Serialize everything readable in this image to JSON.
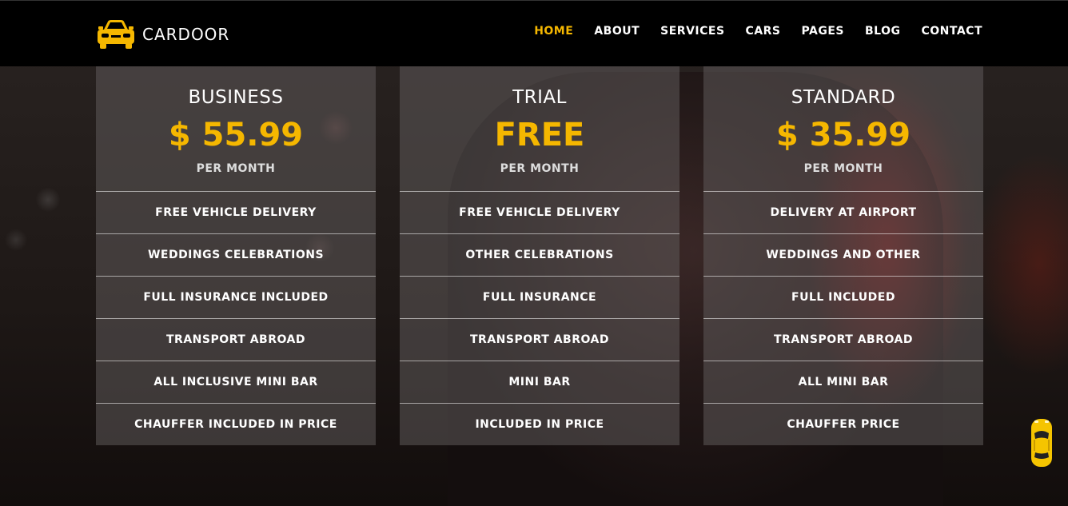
{
  "brand": {
    "name": "CARDOOR",
    "accent_color": "#f5b700",
    "logo_icon": "car-front-icon"
  },
  "nav": {
    "items": [
      {
        "label": "HOME",
        "active": true
      },
      {
        "label": "ABOUT",
        "active": false
      },
      {
        "label": "SERVICES",
        "active": false
      },
      {
        "label": "CARS",
        "active": false
      },
      {
        "label": "PAGES",
        "active": false
      },
      {
        "label": "BLOG",
        "active": false
      },
      {
        "label": "CONTACT",
        "active": false
      }
    ]
  },
  "plans": [
    {
      "name": "BUSINESS",
      "price": "$ 55.99",
      "period": "PER MONTH",
      "features": [
        "FREE VEHICLE DELIVERY",
        "WEDDINGS CELEBRATIONS",
        "FULL INSURANCE INCLUDED",
        "TRANSPORT ABROAD",
        "ALL INCLUSIVE MINI BAR",
        "CHAUFFER INCLUDED IN PRICE"
      ]
    },
    {
      "name": "TRIAL",
      "price": "FREE",
      "period": "PER MONTH",
      "features": [
        "FREE VEHICLE DELIVERY",
        "OTHER CELEBRATIONS",
        "FULL INSURANCE",
        "TRANSPORT ABROAD",
        "MINI BAR",
        "INCLUDED IN PRICE"
      ]
    },
    {
      "name": "STANDARD",
      "price": "$ 35.99",
      "period": "PER MONTH",
      "features": [
        "DELIVERY AT AIRPORT",
        "WEDDINGS AND OTHER",
        "FULL INCLUDED",
        "TRANSPORT ABROAD",
        "ALL MINI BAR",
        "CHAUFFER PRICE"
      ]
    }
  ],
  "floating_widget": {
    "icon": "car-top-view-icon"
  }
}
